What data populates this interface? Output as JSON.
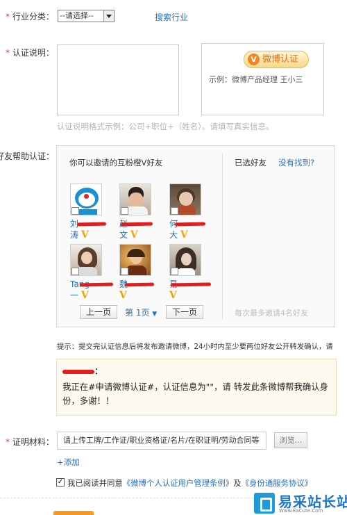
{
  "industry": {
    "label": "行业分类：",
    "select_value": "--请选择--",
    "search_link": "搜索行业"
  },
  "auth_desc": {
    "label": "认证说明：",
    "badge": "微博认证",
    "badge_icon": "V",
    "example": "示例：微博产品经理  王小三",
    "hint": "认证说明格式示例：公司+职位+（姓名）。请填写真实信息。"
  },
  "friends": {
    "label": "好友帮助认证：",
    "invite_title": "你可以邀请的互粉橙V好友",
    "selected_title": "已选好友",
    "not_found": "没有找到?",
    "verified_mark": "V",
    "list": [
      {
        "name_line1": "刘",
        "name_line2": "涛",
        "avatar": "doraemon-avatar",
        "color": "#1b8fd6"
      },
      {
        "name_line1": "赵",
        "name_line2": "文",
        "avatar": "man-avatar",
        "color": "#c5a48b"
      },
      {
        "name_line1": "何",
        "name_line2": "大",
        "avatar": "child-avatar",
        "color": "#8a6a50"
      },
      {
        "name_line1": "Tang",
        "name_line2": "一",
        "avatar": "girl-avatar",
        "color": "#7a5a4a"
      },
      {
        "name_line1": "魏",
        "name_line2": "",
        "avatar": "warm-avatar",
        "color": "#c88a3a"
      },
      {
        "name_line1": "易",
        "name_line2": "",
        "avatar": "sepia-avatar",
        "color": "#9a8a7a"
      }
    ],
    "prev": "上一页",
    "page": "第 1页",
    "next": "下一页",
    "max_hint": "每次最多邀请4名好友"
  },
  "tip": "提示：提交完认证信息后将发布邀请微博，24小时内至少要两位好友公开转发确认，请",
  "notice": {
    "name": "：",
    "message": "我正在#申请微博认证#，认证信息为\"\"，请 转发此条微博帮我确认身份，多谢！！"
  },
  "proof": {
    "label": "证明材料：",
    "placeholder": "请上传工牌/工作证/职业资格证/名片/在职证明/劳动合同等",
    "browse": "浏览...",
    "add": "+添加"
  },
  "agree": {
    "prefix": "我已阅读并同意",
    "link1": "《微博个人认证用户管理条例》",
    "and": "及",
    "link2": "《身份通服务协议》"
  },
  "watermark": {
    "title": "易采站长站",
    "url": "Www.EaCute.Com"
  }
}
